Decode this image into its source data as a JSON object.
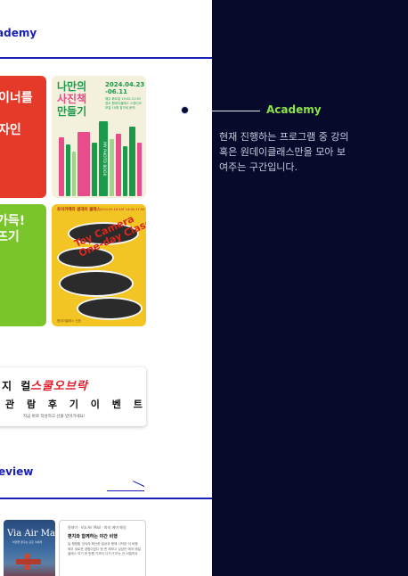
{
  "left_panel": {
    "academy_section_title": "ademy",
    "review_section_title": "eview",
    "cards": {
      "red_text_line1": "이너를",
      "red_text_line2": "자인",
      "green_text_line1": "가득!",
      "green_text_line2": " 뜨기",
      "photo_book": {
        "title_line1": "나만의",
        "title_line2": "사진책",
        "title_line3": "만들기",
        "date_line1": "2024.04.23",
        "date_line2": "-06.11",
        "small_text": "매주 화요일 19:00-21:30 장소 원데이클래스 스튜디오 모집 10명 참가비 문의",
        "spine_text": "MY PHOTO BOOK"
      },
      "toy_camera": {
        "header_left": "토이카메라 원데이 클래스",
        "header_right": "2024.05.18 SAT 14:00-17:00",
        "big_text_line1": "Toy Camera",
        "big_text_line2": "One-day Class",
        "footer": "원데이클래스 신청"
      }
    },
    "banner": {
      "line1": "지 컬",
      "brand": "스쿨오브락",
      "line2": "관 람 후 기  이 벤 트",
      "line3": "지금 바로 작성하고 선물 받아가세요!"
    },
    "review": {
      "image_title": "Via Air Mail",
      "image_subtitle": "비행을 꿈꾸는 모든 이에게",
      "meta": "원데이 · Via Air Mail · 파리 에어 메일",
      "title": "편지와 함께하는 야간 비행",
      "body": "늘 평범할 것이라 확신한 일상과 함께 시작된 이 비행 매우 새로운 경험이었다 한 번 해보고 싶었던 에어 메일 클래스 여기 한 번쯤 가까이 다가가 보는 건 어떨까요"
    }
  },
  "right_panel": {
    "label": "Academy",
    "description": "현재 진행하는 프로그램 중 강의 혹은 원데이클래스만을 모아 보여주는 구간입니다."
  },
  "colors": {
    "navy": "#070a2a",
    "brand_blue": "#1a1fb5",
    "accent_green": "#8be24a",
    "card_red": "#e53a2a",
    "card_green": "#7ac52c",
    "card_yellow": "#f2c424"
  }
}
